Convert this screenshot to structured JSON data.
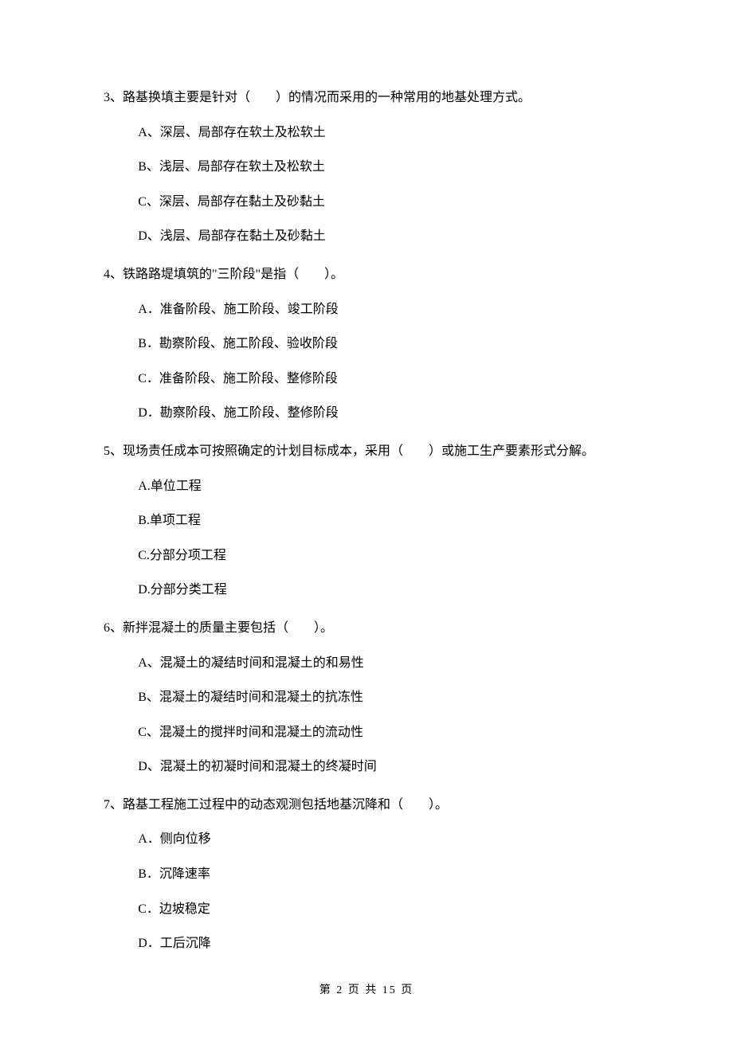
{
  "questions": [
    {
      "number": "3、",
      "stem": "路基换填主要是针对（　　）的情况而采用的一种常用的地基处理方式。",
      "options": [
        "A、深层、局部存在软土及松软土",
        "B、浅层、局部存在软土及松软土",
        "C、深层、局部存在黏土及砂黏土",
        "D、浅层、局部存在黏土及砂黏土"
      ]
    },
    {
      "number": "4、",
      "stem": "铁路路堤填筑的\"三阶段\"是指（　　）。",
      "options": [
        "A．准备阶段、施工阶段、竣工阶段",
        "B．勘察阶段、施工阶段、验收阶段",
        "C．准备阶段、施工阶段、整修阶段",
        "D．勘察阶段、施工阶段、整修阶段"
      ]
    },
    {
      "number": "5、",
      "stem": "现场责任成本可按照确定的计划目标成本，采用（　　）或施工生产要素形式分解。",
      "options": [
        "A.单位工程",
        "B.单项工程",
        "C.分部分项工程",
        "D.分部分类工程"
      ]
    },
    {
      "number": "6、",
      "stem": "新拌混凝土的质量主要包括（　　）。",
      "options": [
        "A、混凝土的凝结时间和混凝土的和易性",
        "B、混凝土的凝结时间和混凝土的抗冻性",
        "C、混凝土的搅拌时间和混凝土的流动性",
        "D、混凝土的初凝时间和混凝土的终凝时间"
      ]
    },
    {
      "number": "7、",
      "stem": "路基工程施工过程中的动态观测包括地基沉降和（　　）。",
      "options": [
        "A．侧向位移",
        "B．沉降速率",
        "C．边坡稳定",
        "D．工后沉降"
      ]
    }
  ],
  "footer": "第 2 页 共 15 页"
}
